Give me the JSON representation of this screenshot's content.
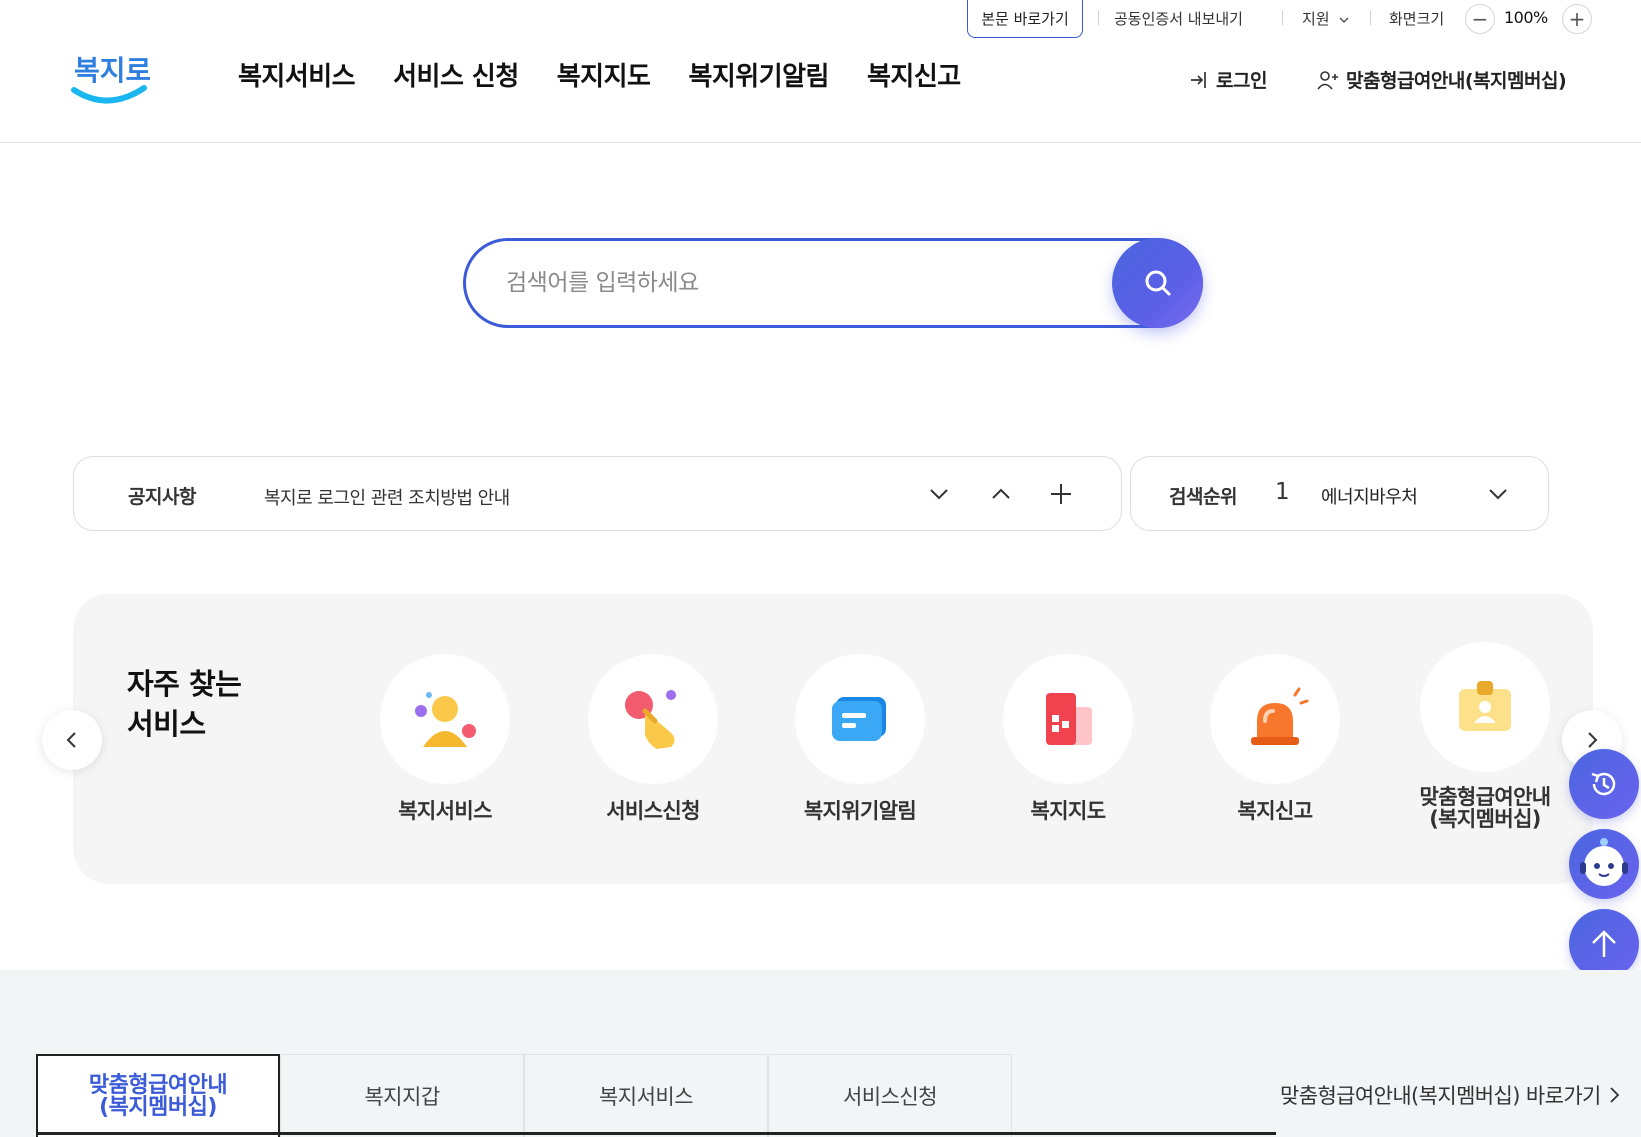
{
  "util": {
    "skip_link": "본문 바로가기",
    "cert_export": "공동인증서 내보내기",
    "support": "지원",
    "zoom_label": "화면크기",
    "zoom_value": "100%",
    "zoom_out": "−",
    "zoom_in": "+"
  },
  "brand": {
    "logo_text": "복지로"
  },
  "nav": {
    "items": [
      {
        "label": "복지서비스"
      },
      {
        "label": "서비스 신청"
      },
      {
        "label": "복지지도"
      },
      {
        "label": "복지위기알림"
      },
      {
        "label": "복지신고"
      }
    ],
    "login": "로그인",
    "membership": "맞춤형급여안내(복지멤버십)"
  },
  "search": {
    "placeholder": "검색어를 입력하세요",
    "value": ""
  },
  "notice": {
    "label": "공지사항",
    "text": "복지로 로그인 관련 조치방법 안내"
  },
  "ranking": {
    "label": "검색순위",
    "rank": "1",
    "keyword": "에너지바우처"
  },
  "frequent": {
    "title_line1": "자주 찾는",
    "title_line2": "서비스",
    "items": [
      {
        "label": "복지서비스",
        "icon": "person-icon"
      },
      {
        "label": "서비스신청",
        "icon": "hand-pointer-icon"
      },
      {
        "label": "복지위기알림",
        "icon": "message-icon"
      },
      {
        "label": "복지지도",
        "icon": "building-icon"
      },
      {
        "label": "복지신고",
        "icon": "siren-icon"
      },
      {
        "label": "맞춤형급여안내",
        "label2": "(복지멤버십)",
        "icon": "id-card-icon"
      }
    ]
  },
  "bottom": {
    "tabs": [
      {
        "label": "맞춤형급여안내",
        "label2": "(복지멤버십)"
      },
      {
        "label": "복지지갑"
      },
      {
        "label": "복지서비스"
      },
      {
        "label": "서비스신청"
      }
    ],
    "goto_link": "맞춤형급여안내(복지멤버십) 바로가기"
  },
  "colors": {
    "brand_blue": "#3b5bd8",
    "gradient_end": "#7a6bf0",
    "panel_bg": "#f5f5f5",
    "bottom_bg": "#f1f5f6"
  }
}
